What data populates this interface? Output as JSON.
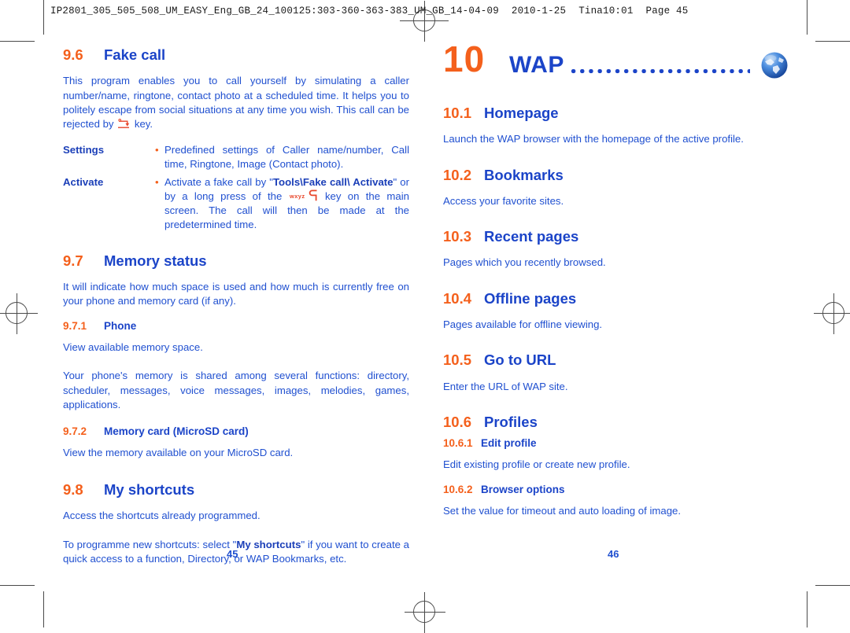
{
  "printer_slug": {
    "file": "IP2801_305_505_508_UM_EASY_Eng_GB_24_100125:303-360-363-383_UM_GB_14-04-09",
    "date": "2010-1-25",
    "operator_time": "Tina10:01",
    "page_label": "Page 45"
  },
  "colors": {
    "heading_number": "#f4601c",
    "heading_title": "#1b44c8",
    "body_text": "#2050d0",
    "bullet": "#f4601c",
    "globe": "#2f6fd0"
  },
  "left_page": {
    "folio": "45",
    "sections": [
      {
        "number": "9.6",
        "title": "Fake call",
        "paragraphs": [
          {
            "before": "This program enables you to call yourself by simulating a caller number/name, ringtone, contact photo at a scheduled time. It helps you to politely escape from social situations at any time you wish. This call can be rejected by ",
            "icon": "hangup-key-icon",
            "after": " key."
          }
        ],
        "definitions": [
          {
            "term": "Settings",
            "bullet": "•",
            "description": "Predefined settings of Caller name/number, Call time, Ringtone, Image (Contact photo)."
          },
          {
            "term": "Activate",
            "bullet": "•",
            "desc_part1": "Activate a fake call by \"",
            "desc_bold1": "Tools\\Fake call\\ Activate",
            "desc_part2": "\" or by a long press of the ",
            "icon": "wxyz9-key-icon",
            "desc_part3": " key on the main screen. The call will then be made at the predetermined time."
          }
        ]
      },
      {
        "number": "9.7",
        "title": "Memory status",
        "intro": "It will indicate how much space is used and how much is currently free on your phone and memory card (if any).",
        "subsections": [
          {
            "number": "9.7.1",
            "title": "Phone",
            "paragraphs": [
              "View available memory space.",
              "Your phone's memory is shared among several functions: directory, scheduler, messages, voice messages, images, melodies, games, applications."
            ]
          },
          {
            "number": "9.7.2",
            "title": "Memory card (MicroSD card)",
            "paragraphs": [
              "View the memory available on your MicroSD card."
            ]
          }
        ]
      },
      {
        "number": "9.8",
        "title": "My shortcuts",
        "paragraphs_plain": [
          "Access the shortcuts already programmed."
        ],
        "last_paragraph": {
          "part1": "To programme new shortcuts: select \"",
          "bold1": "My shortcuts",
          "part2": "\" if you want to create a quick access to a function, Directory, or WAP Bookmarks, etc."
        }
      }
    ]
  },
  "right_page": {
    "folio": "46",
    "chapter": {
      "number": "10",
      "title": "WAP",
      "icon": "globe-icon"
    },
    "sections": [
      {
        "number": "10.1",
        "title": "Homepage",
        "body": "Launch the WAP browser with the homepage of the active profile."
      },
      {
        "number": "10.2",
        "title": "Bookmarks",
        "body": "Access your favorite sites."
      },
      {
        "number": "10.3",
        "title": "Recent pages",
        "body": "Pages which you recently browsed."
      },
      {
        "number": "10.4",
        "title": "Offline pages",
        "body": "Pages available for offline viewing."
      },
      {
        "number": "10.5",
        "title": "Go to URL",
        "body": "Enter the URL of WAP site."
      },
      {
        "number": "10.6",
        "title": "Profiles",
        "subsections": [
          {
            "number": "10.6.1",
            "title": "Edit profile",
            "body": "Edit existing profile or create new profile."
          },
          {
            "number": "10.6.2",
            "title": "Browser options",
            "body": "Set the value for timeout and auto loading of image."
          }
        ]
      }
    ]
  }
}
